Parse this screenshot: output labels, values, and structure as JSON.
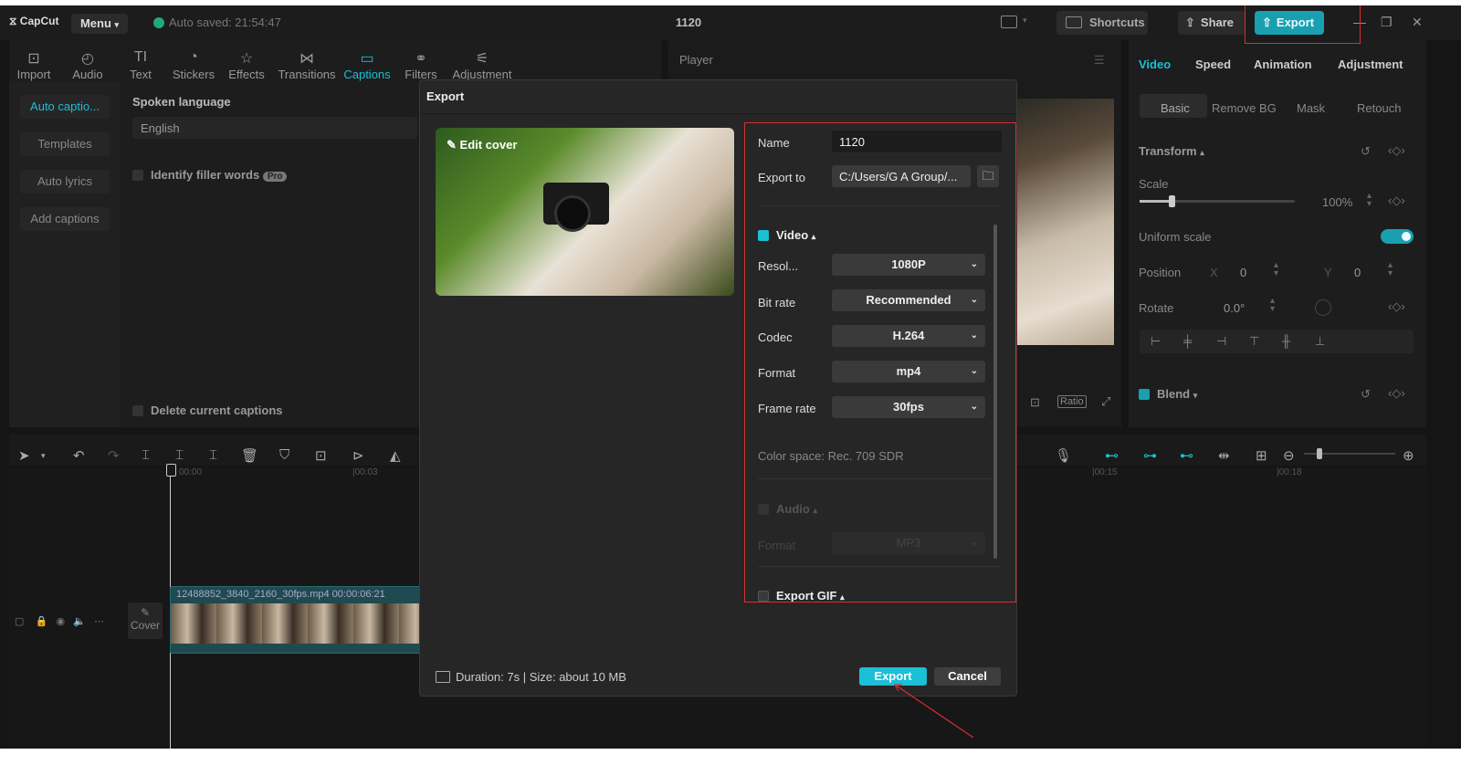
{
  "app": {
    "logo": "CapCut",
    "menu_label": "Menu",
    "autosave": "Auto saved: 21:54:47",
    "project_title": "1120",
    "shortcuts_label": "Shortcuts",
    "share_label": "Share",
    "export_label": "Export"
  },
  "toolbar": {
    "items": [
      {
        "label": "Import",
        "icon": "import-icon"
      },
      {
        "label": "Audio",
        "icon": "audio-icon"
      },
      {
        "label": "Text",
        "icon": "text-icon"
      },
      {
        "label": "Stickers",
        "icon": "stickers-icon"
      },
      {
        "label": "Effects",
        "icon": "effects-icon"
      },
      {
        "label": "Transitions",
        "icon": "transitions-icon"
      },
      {
        "label": "Captions",
        "icon": "captions-icon"
      },
      {
        "label": "Filters",
        "icon": "filters-icon"
      },
      {
        "label": "Adjustment",
        "icon": "adjustment-icon"
      }
    ]
  },
  "captions_panel": {
    "items": [
      "Auto captio...",
      "Templates",
      "Auto lyrics",
      "Add captions"
    ],
    "spoken_language_label": "Spoken language",
    "language_value": "English",
    "filler_words_label": "Identify filler words",
    "pro_badge": "Pro",
    "delete_captions_label": "Delete current captions"
  },
  "player": {
    "title": "Player",
    "ratio_label": "Ratio"
  },
  "right_panel": {
    "tabs": [
      "Video",
      "Speed",
      "Animation",
      "Adjustment"
    ],
    "subtabs": [
      "Basic",
      "Remove BG",
      "Mask",
      "Retouch"
    ],
    "transform_label": "Transform",
    "scale_label": "Scale",
    "scale_value": "100%",
    "uniform_scale_label": "Uniform scale",
    "position_label": "Position",
    "pos_x_label": "X",
    "pos_x_value": "0",
    "pos_y_label": "Y",
    "pos_y_value": "0",
    "rotate_label": "Rotate",
    "rotate_value": "0.0°",
    "blend_label": "Blend"
  },
  "timeline": {
    "times": [
      "00:00",
      "|00:03",
      "|00:15",
      "|00:18"
    ],
    "clip_label": "12488852_3840_2160_30fps.mp4  00:00:06:21",
    "cover_label": "Cover"
  },
  "export_dialog": {
    "title": "Export",
    "edit_cover_label": "Edit cover",
    "name_label": "Name",
    "name_value": "1120",
    "export_to_label": "Export to",
    "export_to_value": "C:/Users/G A Group/...",
    "video_section": "Video",
    "resolution_label": "Resol...",
    "resolution_value": "1080P",
    "bitrate_label": "Bit rate",
    "bitrate_value": "Recommended",
    "codec_label": "Codec",
    "codec_value": "H.264",
    "format_label": "Format",
    "format_value": "mp4",
    "framerate_label": "Frame rate",
    "framerate_value": "30fps",
    "color_space": "Color space: Rec. 709 SDR",
    "audio_section": "Audio",
    "audio_format_label": "Format",
    "audio_format_value": "MP3",
    "gif_section": "Export GIF",
    "duration_size": "Duration: 7s | Size: about 10 MB",
    "export_button": "Export",
    "cancel_button": "Cancel"
  },
  "colors": {
    "accent": "#1bbfd6",
    "highlight": "#d63030"
  }
}
